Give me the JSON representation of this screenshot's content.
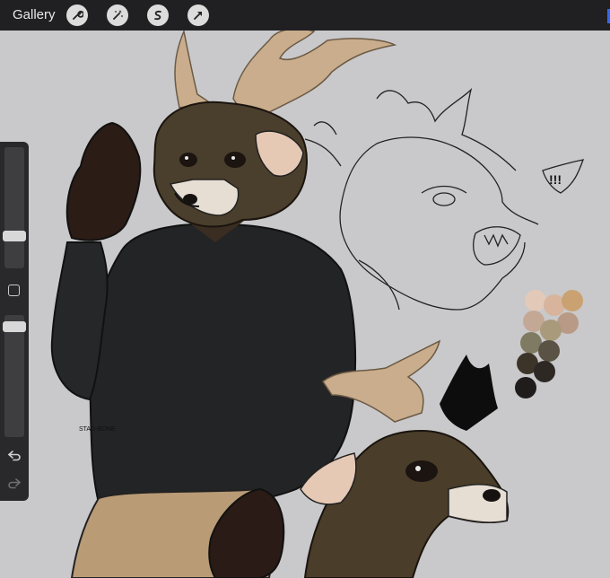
{
  "app": {
    "gallery_label": "Gallery"
  },
  "toolbar": {
    "icons": [
      "wrench-icon",
      "magic-wand-icon",
      "selection-icon",
      "transform-arrow-icon"
    ]
  },
  "canvas": {
    "background": "#c9c9cb",
    "sketch_text": "!!!",
    "signature": "STAG-BONE"
  },
  "sidebar": {
    "brush_size_level": 0.5,
    "opacity_level": 0.95,
    "modifier_icon": "square-icon",
    "undo_icon": "undo-icon",
    "redo_icon": "redo-icon"
  },
  "palette": [
    "#e3c9b8",
    "#d8b49c",
    "#caa272",
    "#c4a896",
    "#b89a86",
    "#a99a7c",
    "#7f7a62",
    "#5a5245",
    "#3c3429",
    "#2e2825",
    "#1f1c1b"
  ]
}
